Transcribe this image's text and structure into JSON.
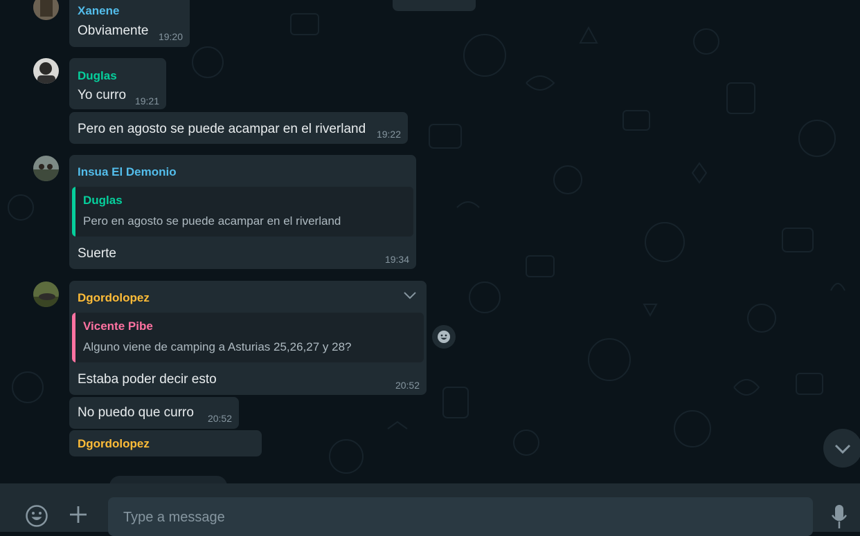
{
  "colors": {
    "chat_bg": "#0b141a",
    "bubble": "#202c33",
    "text": "#e9edef",
    "meta": "#8696a0",
    "footer": "#202c33",
    "input": "#2a3942",
    "xanene": "#53bdeb",
    "duglas": "#06cf9c",
    "insua": "#53bdeb",
    "dgordolopez": "#ffbc38",
    "vicente": "#ff72a1"
  },
  "messages": [
    {
      "sender": "Xanene",
      "text": "Obviamente",
      "time": "19:20"
    },
    {
      "sender": "Duglas",
      "text": "Yo curro",
      "time": "19:21"
    },
    {
      "text": "Pero en agosto se puede acampar en el riverland",
      "time": "19:22"
    },
    {
      "sender": "Insua El Demonio",
      "quote": {
        "name": "Duglas",
        "text": "Pero en agosto se puede acampar en el riverland"
      },
      "text": "Suerte",
      "time": "19:34"
    },
    {
      "sender": "Dgordolopez",
      "quote": {
        "name": "Vicente Pibe",
        "text": "Alguno viene de camping a Asturias 25,26,27 y 28?"
      },
      "text": "Estaba poder decir esto",
      "time": "20:52"
    },
    {
      "text": "No puedo que curro",
      "time": "20:52"
    },
    {
      "sender": "Dgordolopez"
    }
  ],
  "composer": {
    "placeholder": "Type a message",
    "emoji_icon": "emoji-icon",
    "attach_icon": "plus-icon",
    "mic_icon": "microphone-icon"
  }
}
